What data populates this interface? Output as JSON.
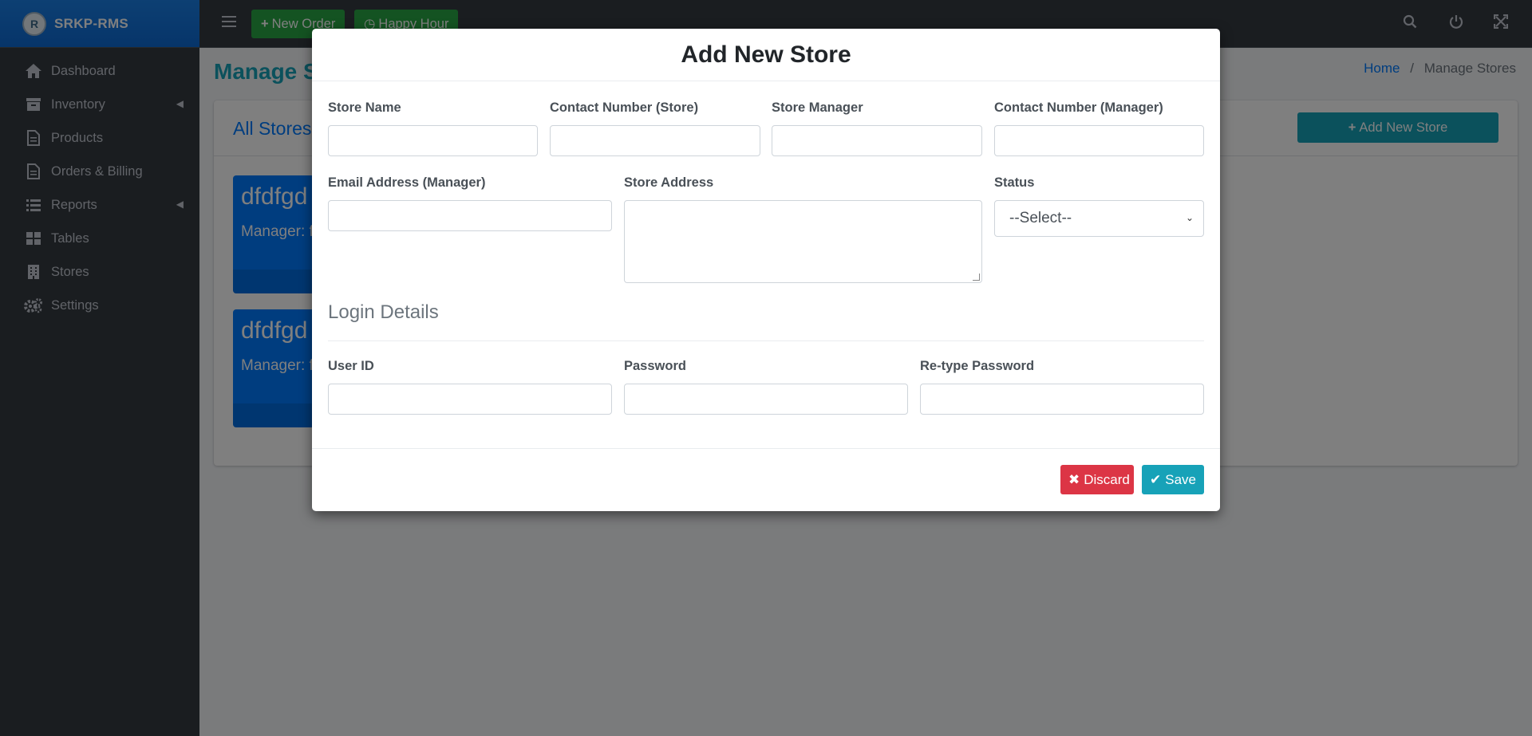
{
  "brand": {
    "name": "SRKP-RMS",
    "logo_text": "R"
  },
  "sidebar": {
    "items": [
      {
        "label": "Dashboard",
        "icon": "home-icon",
        "has_arrow": false
      },
      {
        "label": "Inventory",
        "icon": "inbox-icon",
        "has_arrow": true
      },
      {
        "label": "Products",
        "icon": "document-icon",
        "has_arrow": false
      },
      {
        "label": "Orders & Billing",
        "icon": "document-icon",
        "has_arrow": false
      },
      {
        "label": "Reports",
        "icon": "list-icon",
        "has_arrow": true
      },
      {
        "label": "Tables",
        "icon": "grid-icon",
        "has_arrow": false
      },
      {
        "label": "Stores",
        "icon": "building-icon",
        "has_arrow": false
      },
      {
        "label": "Settings",
        "icon": "gears-icon",
        "has_arrow": false
      }
    ]
  },
  "topbar": {
    "new_order": "New Order",
    "happy_hour": "Happy Hour",
    "icons": [
      "search-icon",
      "power-icon",
      "fullscreen-icon"
    ]
  },
  "page": {
    "title": "Manage Stores",
    "breadcrumb_home": "Home",
    "breadcrumb_sep": "/",
    "breadcrumb_current": "Manage Stores",
    "card_title": "All Stores",
    "add_button": "Add New Store"
  },
  "stores": [
    {
      "name": "dfdfgd",
      "manager": "Manager: f"
    },
    {
      "name": "dfdfgd",
      "manager": "Manager: f"
    }
  ],
  "modal": {
    "title": "Add New Store",
    "fields": {
      "store_name": "Store Name",
      "contact_store": "Contact Number (Store)",
      "store_manager": "Store Manager",
      "contact_manager": "Contact Number (Manager)",
      "email_manager": "Email Address (Manager)",
      "store_address": "Store Address",
      "status": "Status",
      "status_value": "--Select--",
      "user_id": "User ID",
      "password": "Password",
      "retype_password": "Re-type Password"
    },
    "section_login": "Login Details",
    "discard": "Discard",
    "save": "Save"
  },
  "colors": {
    "sidebar_bg": "#343a40",
    "brand_bg": "#0d6ad4",
    "accent_teal": "#17a2b8",
    "success_green": "#28a745",
    "danger_red": "#dc3545",
    "tile_blue": "#007bff"
  }
}
